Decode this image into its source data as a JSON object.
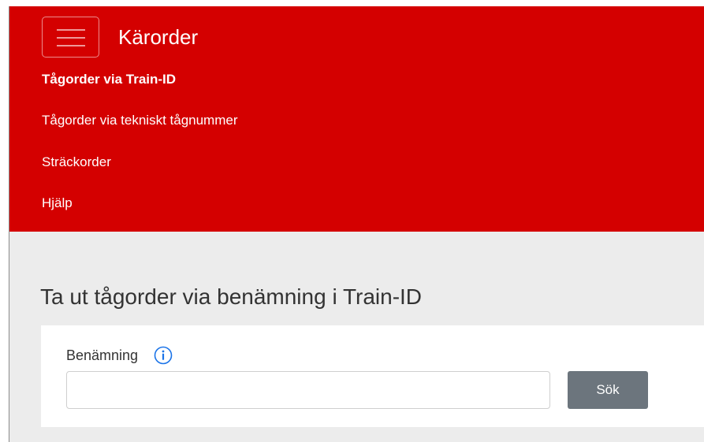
{
  "header": {
    "brand": "Kärorder",
    "menu_toggle_icon": "hamburger-icon",
    "color": "#d40000"
  },
  "nav": {
    "items": [
      {
        "label": "Tågorder via Train-ID",
        "active": true
      },
      {
        "label": "Tågorder via tekniskt tågnummer",
        "active": false
      },
      {
        "label": "Sträckorder",
        "active": false
      },
      {
        "label": "Hjälp",
        "active": false
      }
    ]
  },
  "main": {
    "title": "Ta ut tågorder via benämning i Train-ID",
    "form": {
      "label": "Benämning",
      "info_icon": "info-icon",
      "input_value": "",
      "button_label": "Sök",
      "button_color": "#6c757d"
    }
  }
}
